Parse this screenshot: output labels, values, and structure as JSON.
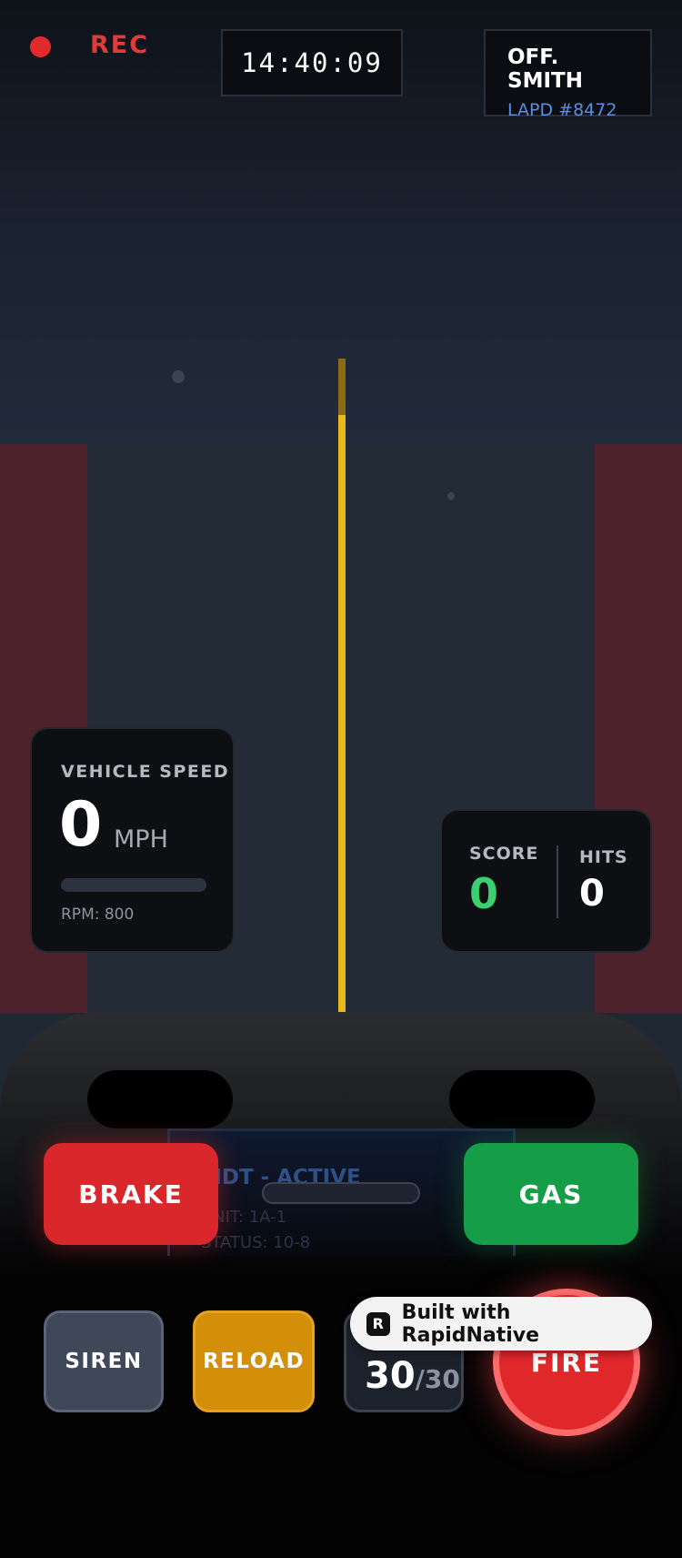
{
  "hud": {
    "rec_label": "REC",
    "clock": "14:40:09",
    "officer_name": "OFF. SMITH",
    "officer_badge": "LAPD #8472"
  },
  "speed": {
    "title": "VEHICLE SPEED",
    "value": "0",
    "unit": "MPH",
    "rpm": "RPM: 800",
    "bar_fraction": 0
  },
  "score": {
    "score_label": "SCORE",
    "score_value": "0",
    "hits_label": "HITS",
    "hits_value": "0"
  },
  "mdt": {
    "title": "MDT - ACTIVE",
    "unit": "UNIT: 1A-1",
    "status": "STATUS: 10-8"
  },
  "controls": {
    "brake": "BRAKE",
    "gas": "GAS",
    "siren": "SIREN",
    "reload": "RELOAD",
    "ammo_current": "30",
    "ammo_max": "/30",
    "fire": "FIRE"
  },
  "badge": {
    "icon": "R",
    "label": "Built with RapidNative"
  },
  "colors": {
    "rec": "#e12b2b",
    "score": "#3ccf6f",
    "brake": "#d9272b",
    "gas": "#169d47",
    "reload": "#d38f0a",
    "fire": "#e0282b",
    "lane": "#e9b81a"
  },
  "icons": [
    "recording-dot-icon",
    "rapidnative-logo-icon"
  ]
}
